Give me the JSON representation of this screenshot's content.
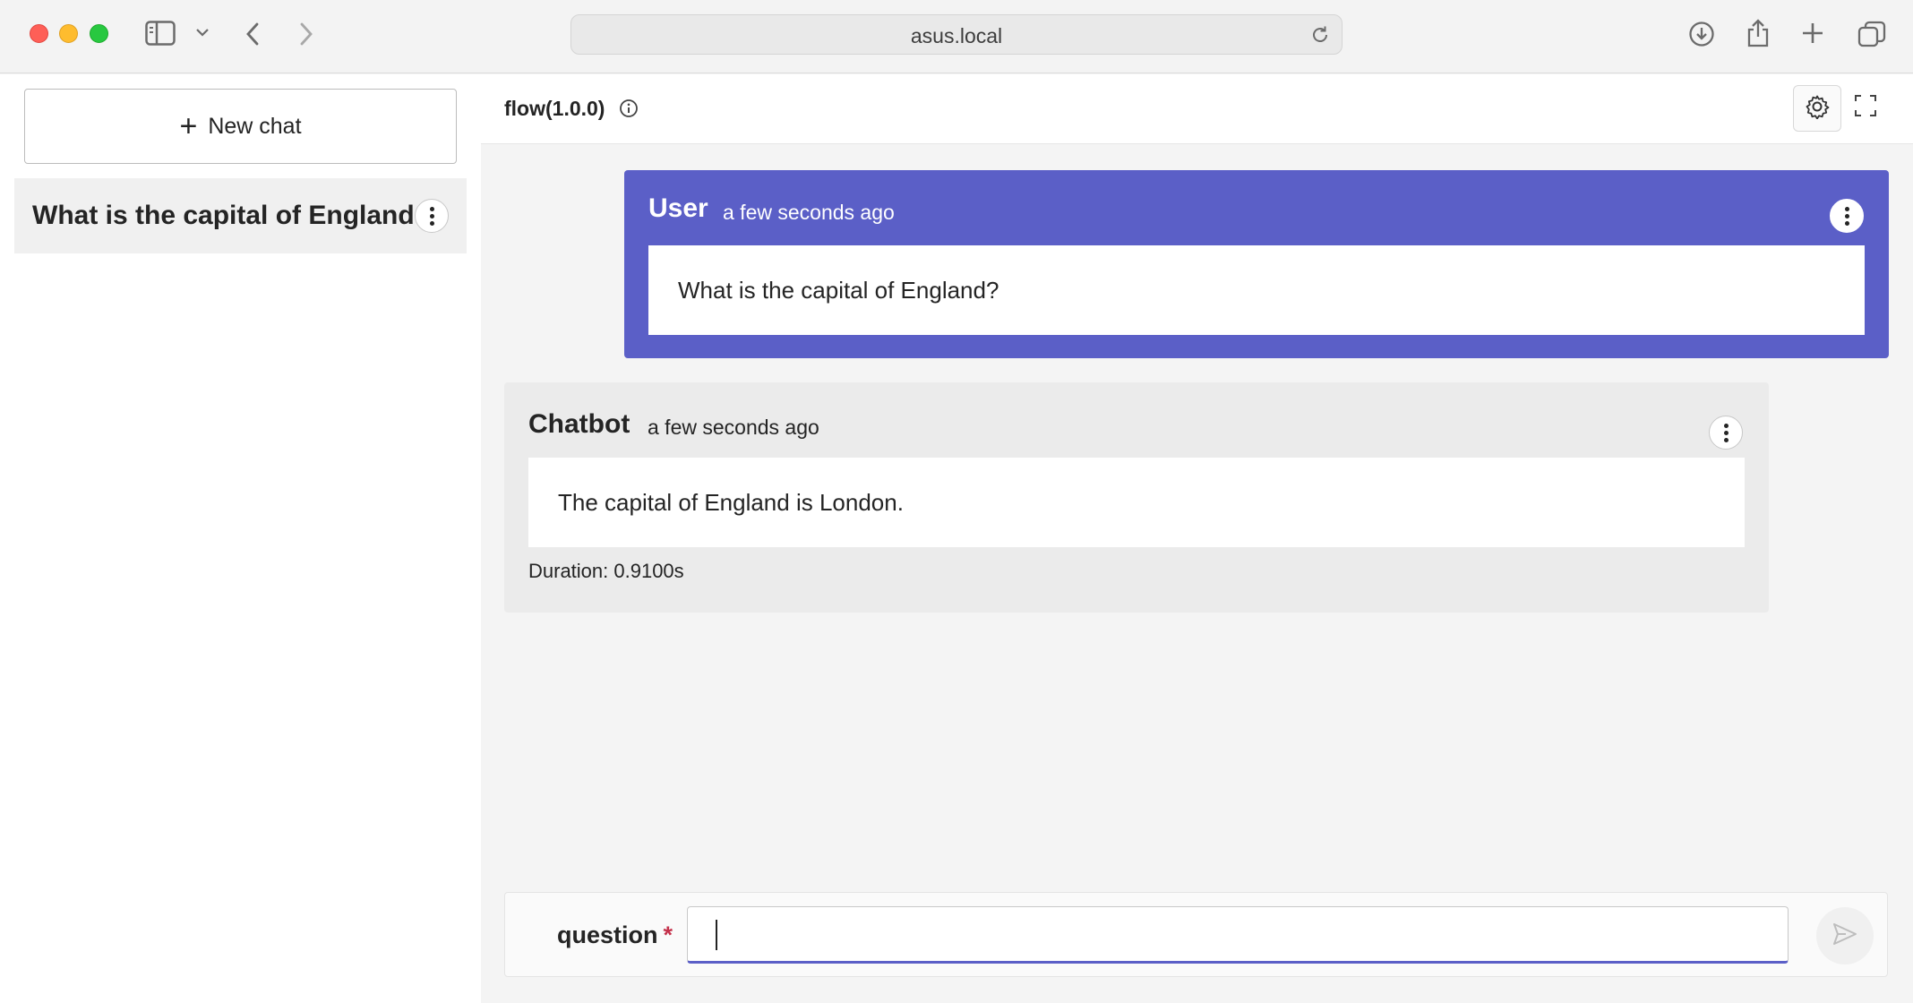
{
  "browser": {
    "url": "asus.local"
  },
  "sidebar": {
    "new_chat_label": "New chat",
    "chats": [
      {
        "title": "What is the capital of England"
      }
    ]
  },
  "header": {
    "flow_title": "flow(1.0.0)"
  },
  "messages": {
    "user": {
      "author": "User",
      "time": "a few seconds ago",
      "text": "What is the capital of England?"
    },
    "bot": {
      "author": "Chatbot",
      "time": "a few seconds ago",
      "text": "The capital of England is London.",
      "duration": "Duration: 0.9100s"
    }
  },
  "input": {
    "label": "question",
    "required_marker": "*",
    "value": ""
  },
  "colors": {
    "accent": "#5b5fc7",
    "required": "#c4314b"
  }
}
